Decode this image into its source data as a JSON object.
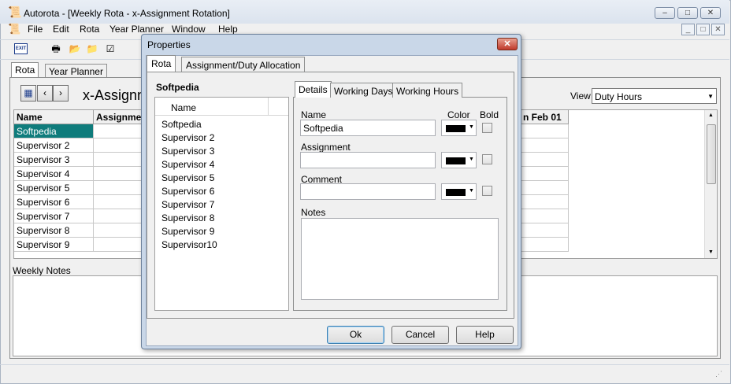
{
  "app": {
    "title": "Autorota - [Weekly Rota - x-Assignment Rotation]",
    "icon": "autorota-icon"
  },
  "menu": {
    "items": [
      "File",
      "Edit",
      "Rota",
      "Year Planner",
      "Window",
      "Help"
    ]
  },
  "toolbar": {
    "exit_label": "EXIT"
  },
  "outer_tabs": [
    "Rota",
    "Year Planner"
  ],
  "rota": {
    "heading": "x-Assignn",
    "view_label": "View",
    "view_value": "Duty Hours",
    "columns": [
      "Name",
      "Assignmer",
      "n Feb 01"
    ],
    "rows": [
      "Softpedia",
      "Supervisor 2",
      "Supervisor 3",
      "Supervisor 4",
      "Supervisor 5",
      "Supervisor 6",
      "Supervisor 7",
      "Supervisor 8",
      "Supervisor 9"
    ],
    "notes_label": "Weekly Notes"
  },
  "dialog": {
    "title": "Properties",
    "tabs": [
      "Rota",
      "Assignment/Duty Allocation"
    ],
    "list_title": "Softpedia",
    "list_header": "Name",
    "names": [
      "Softpedia",
      "Supervisor 2",
      "Supervisor 3",
      "Supervisor 4",
      "Supervisor 5",
      "Supervisor 6",
      "Supervisor 7",
      "Supervisor 8",
      "Supervisor 9",
      "Supervisor10"
    ],
    "detail_tabs": [
      "Details",
      "Working Days",
      "Working Hours"
    ],
    "labels": {
      "name": "Name",
      "color": "Color",
      "bold": "Bold",
      "assignment": "Assignment",
      "comment": "Comment",
      "notes": "Notes"
    },
    "values": {
      "name": "Softpedia",
      "assignment": "",
      "comment": ""
    },
    "colors": {
      "swatch": "#000000"
    },
    "buttons": {
      "ok": "Ok",
      "cancel": "Cancel",
      "help": "Help"
    }
  }
}
